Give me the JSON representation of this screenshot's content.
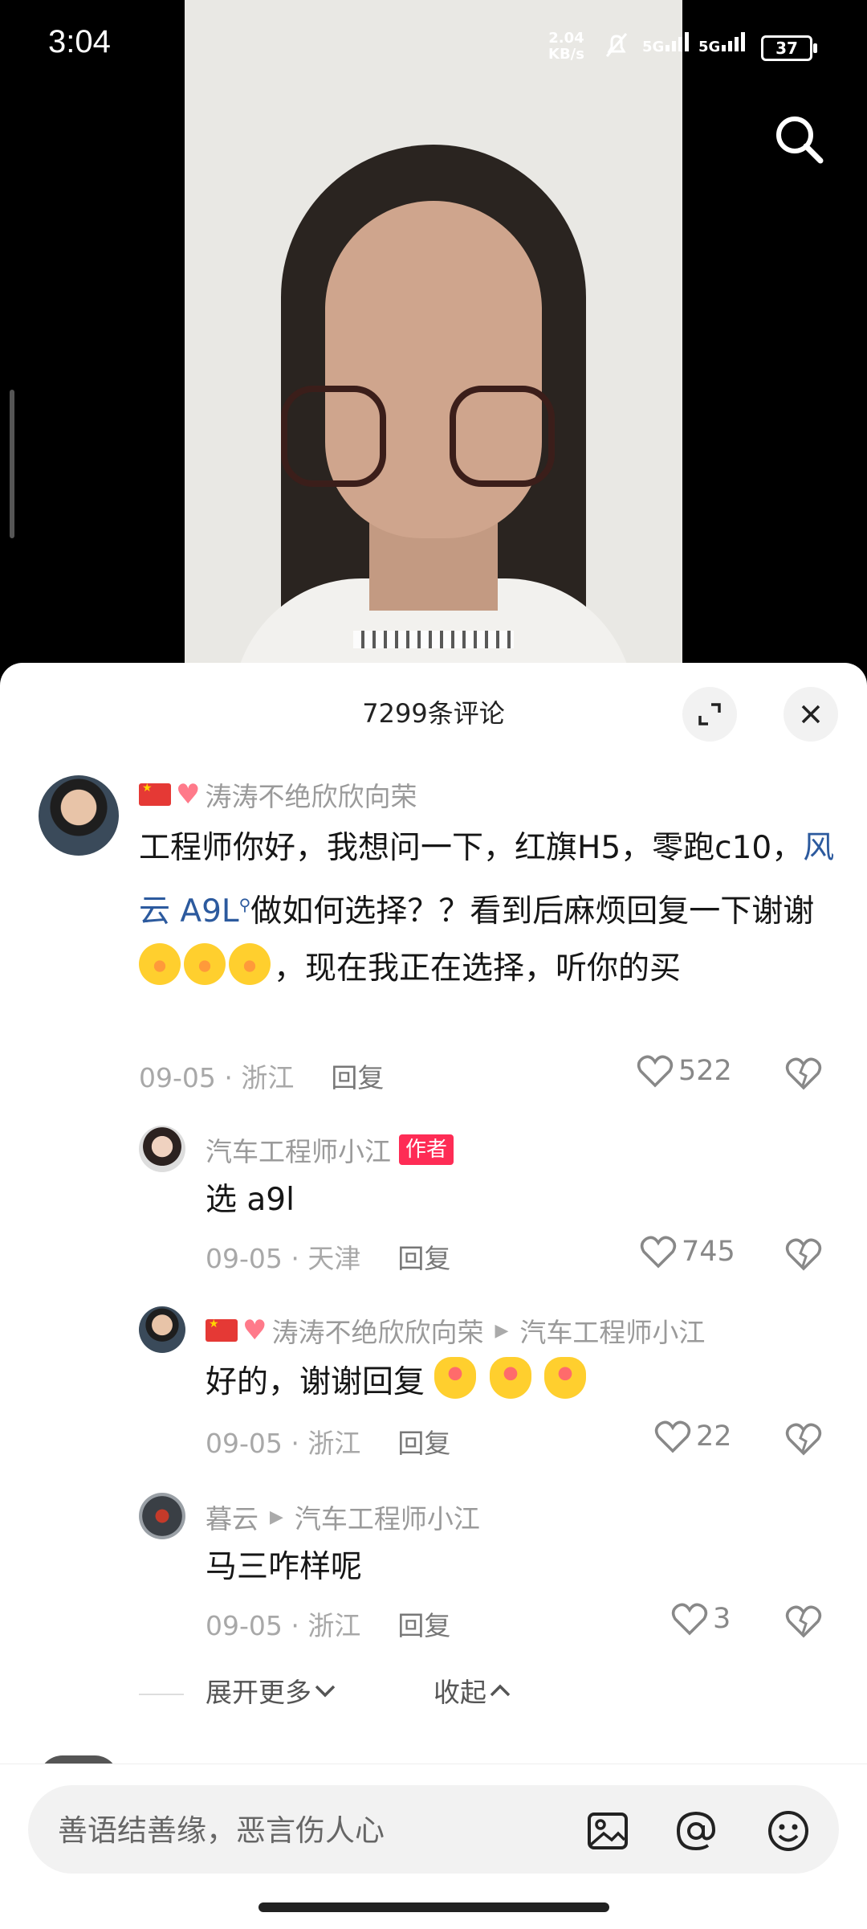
{
  "status_bar": {
    "time": "3:04",
    "net_speed": "2.04",
    "net_unit": "KB/s",
    "sim1": "5G",
    "sim2": "5G",
    "battery": "37"
  },
  "sheet": {
    "title": "7299条评论"
  },
  "comments": [
    {
      "user": "涛涛不绝欣欣向荣",
      "text_1": "工程师你好，我想问一下，红旗H5，零跑c10，",
      "link": "风云 A9L",
      "text_2": "做如何选择？？看到后麻烦回复一下谢谢",
      "text_3": "，现在我正在选择，听你的买",
      "date": "09-05",
      "location": "浙江",
      "reply": "回复",
      "likes": "522"
    },
    {
      "user": "汽车工程师小江",
      "author_tag": "作者",
      "text": "选 a9l",
      "date": "09-05",
      "location": "天津",
      "reply": "回复",
      "likes": "745"
    },
    {
      "user": "涛涛不绝欣欣向荣",
      "reply_to": "汽车工程师小江",
      "text": "好的，谢谢回复",
      "date": "09-05",
      "location": "浙江",
      "reply": "回复",
      "likes": "22"
    },
    {
      "user": "暮云",
      "reply_to": "汽车工程师小江",
      "text": "马三咋样呢",
      "date": "09-05",
      "location": "浙江",
      "reply": "回复",
      "likes": "3"
    }
  ],
  "thread_controls": {
    "expand_more": "展开更多",
    "collapse": "收起"
  },
  "input": {
    "placeholder": "善语结善缘，恶言伤人心"
  },
  "icons": [
    "search-icon",
    "expand-icon",
    "close-icon",
    "heart-icon",
    "broken-heart-icon",
    "image-icon",
    "at-icon",
    "emoji-icon"
  ]
}
